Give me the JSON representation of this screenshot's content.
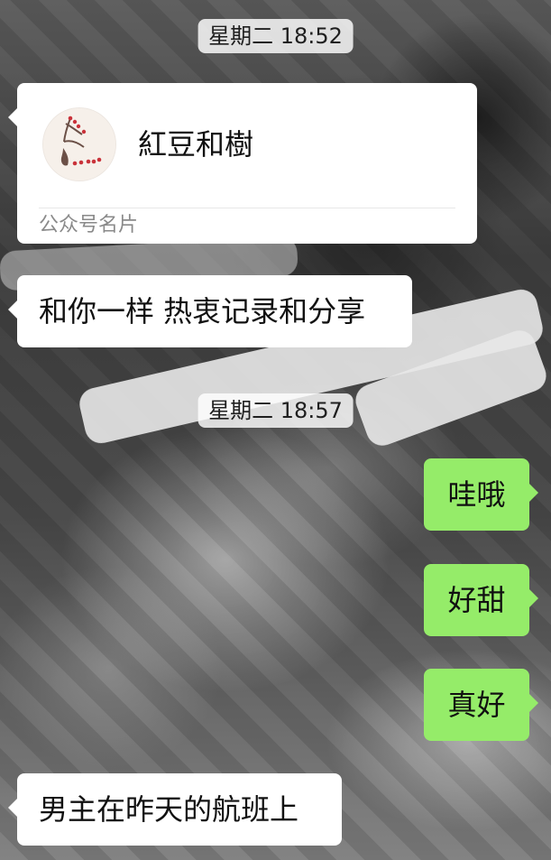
{
  "timestamps": [
    "星期二 18:52",
    "星期二 18:57"
  ],
  "card": {
    "title": "紅豆和樹",
    "footer": "公众号名片"
  },
  "messages": {
    "incoming_1": "和你一样 热衷记录和分享",
    "outgoing_1": "哇哦",
    "outgoing_2": "好甜",
    "outgoing_3": "真好",
    "incoming_2": "男主在昨天的航班上"
  },
  "colors": {
    "incoming_bubble": "#ffffff",
    "outgoing_bubble": "#95ec69",
    "timestamp_bg": "#ffffff"
  },
  "icons": {
    "card_avatar": "avatar-vase-icon"
  }
}
